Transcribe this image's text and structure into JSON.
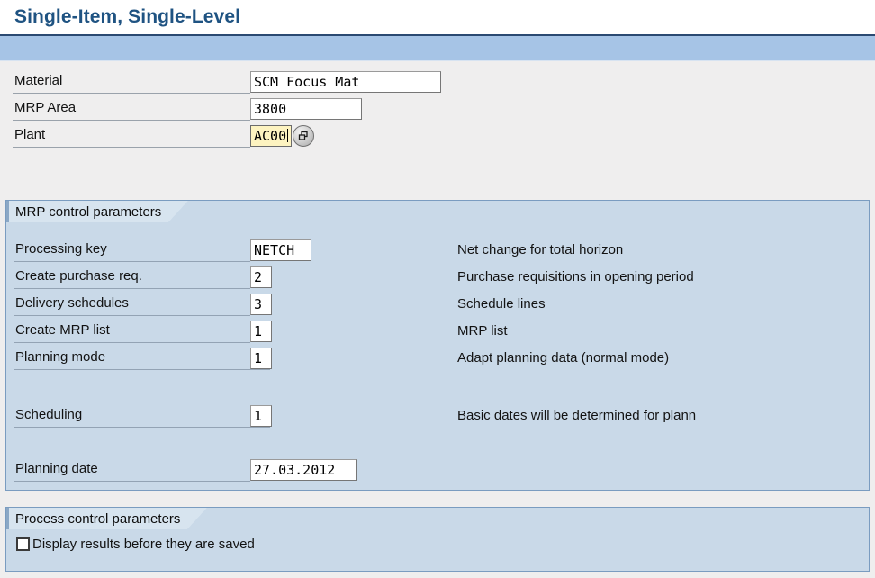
{
  "window": {
    "title": "Single-Item, Single-Level"
  },
  "colors": {
    "title_blue": "#1f5382",
    "toolbar_blue": "#a6c4e6",
    "group_fill": "#c9d9e8",
    "group_border": "#7a9cc0",
    "page_bg": "#efeeee",
    "focused_field": "#fdf3c0"
  },
  "header_fields": [
    {
      "label": "Material",
      "value": "SCM Focus Mat",
      "focused": false
    },
    {
      "label": "MRP Area",
      "value": "3800",
      "focused": false
    },
    {
      "label": "Plant",
      "value": "AC00",
      "focused": true
    }
  ],
  "value_help": {
    "icon": "f4-value-help-icon"
  },
  "groups": [
    {
      "title": "MRP control parameters",
      "rows": [
        {
          "label": "Processing key",
          "value": "NETCH",
          "description": "Net change for total horizon"
        },
        {
          "label": "Create purchase req.",
          "value": "2",
          "description": "Purchase requisitions in opening period"
        },
        {
          "label": "Delivery schedules",
          "value": "3",
          "description": "Schedule lines"
        },
        {
          "label": "Create MRP list",
          "value": "1",
          "description": "MRP list"
        },
        {
          "label": "Planning mode",
          "value": "1",
          "description": "Adapt planning data (normal mode)"
        },
        {
          "label": "Scheduling",
          "value": "1",
          "description": "Basic dates will be determined for plann"
        },
        {
          "label": "Planning date",
          "value": "27.03.2012",
          "description": ""
        }
      ]
    },
    {
      "title": "Process control parameters",
      "checkbox": {
        "label": "Display results before they are saved",
        "checked": false
      }
    }
  ]
}
